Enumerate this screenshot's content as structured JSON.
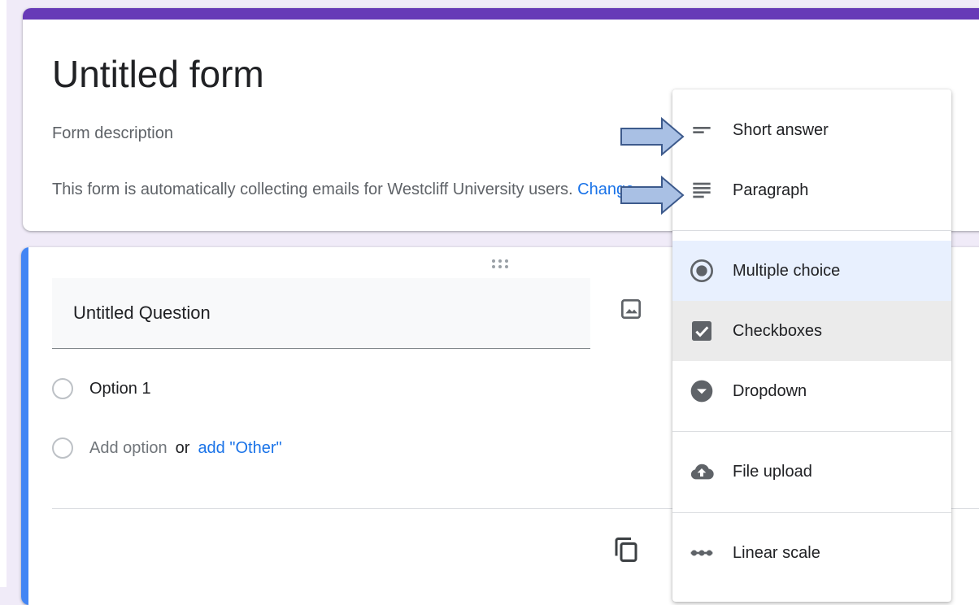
{
  "form": {
    "title": "Untitled form",
    "description": "Form description",
    "email_note": "This form is automatically collecting emails for Westcliff University users.",
    "email_note_link": "Change"
  },
  "question": {
    "title": "Untitled Question",
    "options": [
      {
        "label": "Option 1"
      }
    ],
    "add_option": "Add option",
    "or_text": "or",
    "add_other": "add \"Other\""
  },
  "type_menu": {
    "items": [
      {
        "label": "Short answer",
        "icon": "short-answer-icon"
      },
      {
        "label": "Paragraph",
        "icon": "paragraph-icon"
      },
      {
        "label": "Multiple choice",
        "icon": "radio-button-icon",
        "state": "selected"
      },
      {
        "label": "Checkboxes",
        "icon": "checkbox-icon",
        "state": "hover"
      },
      {
        "label": "Dropdown",
        "icon": "dropdown-icon"
      },
      {
        "label": "File upload",
        "icon": "cloud-upload-icon"
      },
      {
        "label": "Linear scale",
        "icon": "linear-scale-icon"
      }
    ]
  },
  "colors": {
    "accent_purple": "#673ab7",
    "focus_blue": "#4285f4",
    "page_bg": "#f0ebf8",
    "selected_bg": "#e8f0fe",
    "link_blue": "#1a73e8",
    "callout_arrow_fill": "#a9c0e4",
    "callout_arrow_stroke": "#3d5a8c"
  }
}
